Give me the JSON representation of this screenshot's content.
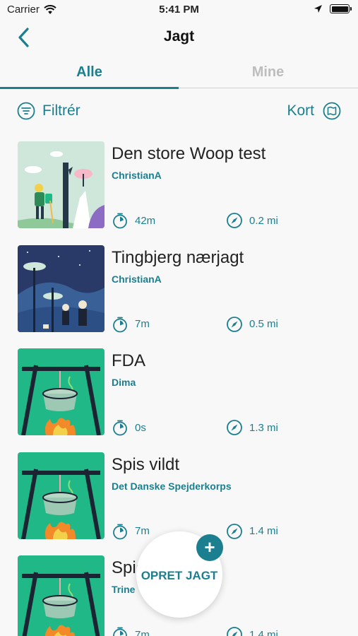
{
  "status_bar": {
    "carrier": "Carrier",
    "time": "5:41 PM"
  },
  "nav": {
    "title": "Jagt",
    "back_icon": "chevron-left-icon"
  },
  "tabs": [
    {
      "label": "Alle",
      "active": true
    },
    {
      "label": "Mine",
      "active": false
    }
  ],
  "toolbar": {
    "filter_label": "Filtrér",
    "map_label": "Kort"
  },
  "hunts": [
    {
      "name": "Den store Woop test",
      "author": "ChristianA",
      "duration": "42m",
      "distance": "0.2 mi",
      "image": "hiker-illustration"
    },
    {
      "name": "Tingbjerg nærjagt",
      "author": "ChristianA",
      "duration": "7m",
      "distance": "0.5 mi",
      "image": "night-forest-illustration"
    },
    {
      "name": "FDA",
      "author": "Dima",
      "duration": "0s",
      "distance": "1.3 mi",
      "image": "campfire-pot-illustration"
    },
    {
      "name": "Spis vildt",
      "author": "Det Danske Spejderkorps",
      "duration": "7m",
      "distance": "1.4 mi",
      "image": "campfire-pot-illustration"
    },
    {
      "name": "Spis",
      "author": "Trine",
      "duration": "7m",
      "distance": "1.4 mi",
      "image": "campfire-pot-illustration"
    }
  ],
  "fab": {
    "label": "OPRET JAGT",
    "icon": "plus-icon"
  },
  "colors": {
    "accent": "#1b7f8f",
    "inactive_tab": "#bdbdbd",
    "background": "#f8f8f8",
    "thumb_green": "#1fb886"
  }
}
